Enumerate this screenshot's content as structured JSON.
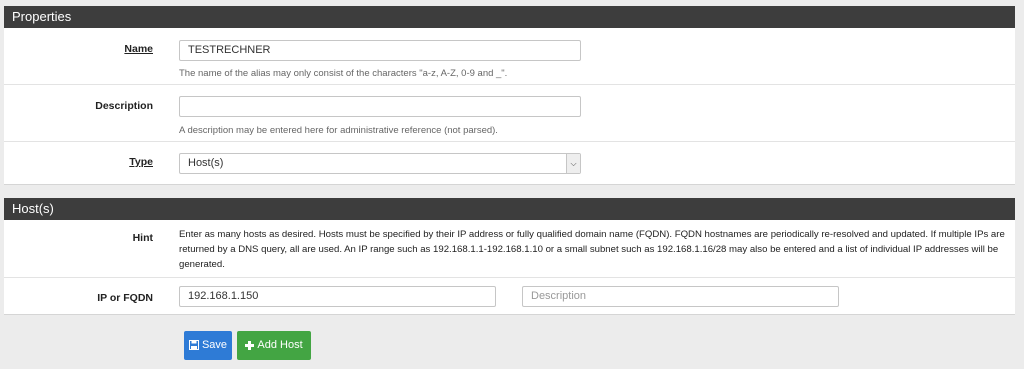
{
  "properties": {
    "title": "Properties",
    "name_label": "Name",
    "name_value": "TESTRECHNER",
    "name_help": "The name of the alias may only consist of the characters \"a-z, A-Z, 0-9 and _\".",
    "description_label": "Description",
    "description_value": "",
    "description_help": "A description may be entered here for administrative reference (not parsed).",
    "type_label": "Type",
    "type_value": "Host(s)"
  },
  "hosts": {
    "title": "Host(s)",
    "hint_label": "Hint",
    "hint_text": "Enter as many hosts as desired. Hosts must be specified by their IP address or fully qualified domain name (FQDN). FQDN hostnames are periodically re-resolved and updated. If multiple IPs are returned by a DNS query, all are used. An IP range such as 192.168.1.1-192.168.1.10 or a small subnet such as 192.168.1.16/28 may also be entered and a list of individual IP addresses will be generated.",
    "ip_label": "IP or FQDN",
    "ip_value": "192.168.1.150",
    "desc_placeholder": "Description"
  },
  "buttons": {
    "save_label": "Save",
    "add_host_label": "Add Host"
  },
  "colors": {
    "header_bg": "#3d3d3d",
    "save_bg": "#2e7bd6",
    "add_bg": "#43a543"
  }
}
